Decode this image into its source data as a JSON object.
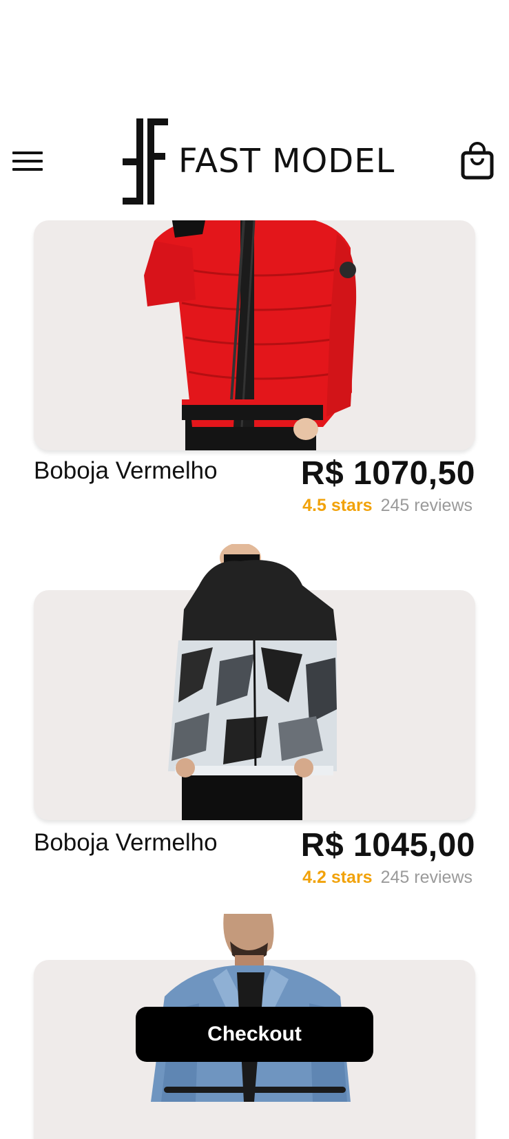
{
  "app": {
    "brand_name": "FAST MODEL"
  },
  "header": {
    "menu_icon": "hamburger-menu-icon",
    "bag_icon": "shopping-bag-icon"
  },
  "products": [
    {
      "name": "Boboja Vermelho",
      "price": "R$ 1070,50",
      "stars_text": "4.5 stars",
      "reviews_text": "245 reviews",
      "jacket_color": "#e3161b",
      "image": "red-puffer-jacket-photo"
    },
    {
      "name": "Boboja Vermelho",
      "price": "R$ 1045,00",
      "stars_text": "4.2 stars",
      "reviews_text": "245 reviews",
      "jacket_color": "#d9dfe4",
      "image": "camo-puffer-jacket-photo"
    },
    {
      "name": "",
      "price": "",
      "stars_text": "",
      "reviews_text": "",
      "jacket_color": "#6f95c0",
      "image": "denim-jacket-photo"
    }
  ],
  "checkout": {
    "label": "Checkout"
  },
  "colors": {
    "accent_star": "#f1a20a",
    "card_bg": "#efebea",
    "button_bg": "#000000"
  }
}
